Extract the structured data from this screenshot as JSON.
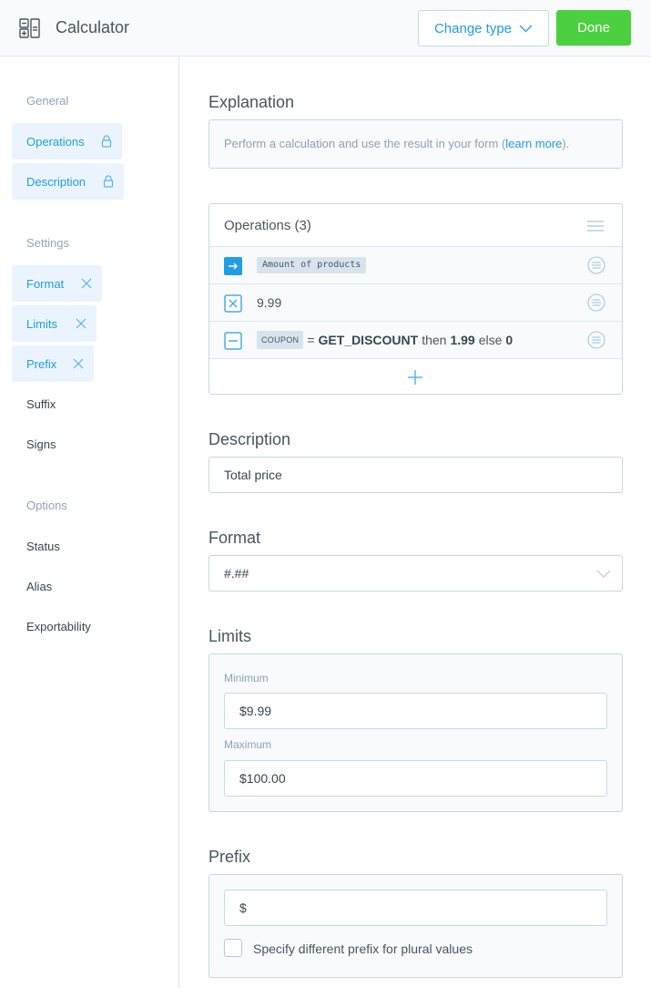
{
  "header": {
    "app_icon": "calculator-icon",
    "title": "Calculator",
    "change_type_label": "Change type",
    "change_type_icon": "chevron-down-icon",
    "done_label": "Done"
  },
  "sidebar": {
    "general": {
      "heading": "General",
      "items": [
        {
          "label": "Operations",
          "icon": "lock-icon",
          "active": true
        },
        {
          "label": "Description",
          "icon": "lock-icon",
          "active": true
        }
      ]
    },
    "settings": {
      "heading": "Settings",
      "items": [
        {
          "label": "Format",
          "icon": "close-icon",
          "active": true
        },
        {
          "label": "Limits",
          "icon": "close-icon",
          "active": true
        },
        {
          "label": "Prefix",
          "icon": "close-icon",
          "active": true
        },
        {
          "label": "Suffix",
          "active": false
        },
        {
          "label": "Signs",
          "active": false
        }
      ]
    },
    "options": {
      "heading": "Options",
      "items": [
        {
          "label": "Status"
        },
        {
          "label": "Alias"
        },
        {
          "label": "Exportability"
        }
      ]
    }
  },
  "main": {
    "explanation": {
      "title": "Explanation",
      "text_before": "Perform a calculation and use the result in your form (",
      "link": "learn more",
      "text_after": ")."
    },
    "operations": {
      "title": "Operations (3)",
      "rows": [
        {
          "operator": "start",
          "icon": "arrow-right-icon",
          "tag": "Amount of products"
        },
        {
          "operator": "multiply",
          "icon": "multiply-icon",
          "value": "9.99"
        },
        {
          "operator": "subtract",
          "icon": "minus-icon",
          "tag": "COUPON",
          "eq": "=",
          "condition": "GET_DISCOUNT",
          "then_word": "then",
          "then_value": "1.99",
          "else_word": "else",
          "else_value": "0"
        }
      ],
      "add_icon": "plus-icon"
    },
    "description": {
      "title": "Description",
      "value": "Total price"
    },
    "format": {
      "title": "Format",
      "selected": "#.##"
    },
    "limits": {
      "title": "Limits",
      "minimum_label": "Minimum",
      "minimum_value": "$9.99",
      "maximum_label": "Maximum",
      "maximum_value": "$100.00"
    },
    "prefix": {
      "title": "Prefix",
      "value": "$",
      "plural_checkbox_label": "Specify different prefix for plural values",
      "plural_checked": false
    }
  },
  "colors": {
    "accent": "#1f9ee4",
    "done": "#4cd040",
    "pill_bg": "#ebf4fd",
    "border": "#c8d8e4"
  }
}
